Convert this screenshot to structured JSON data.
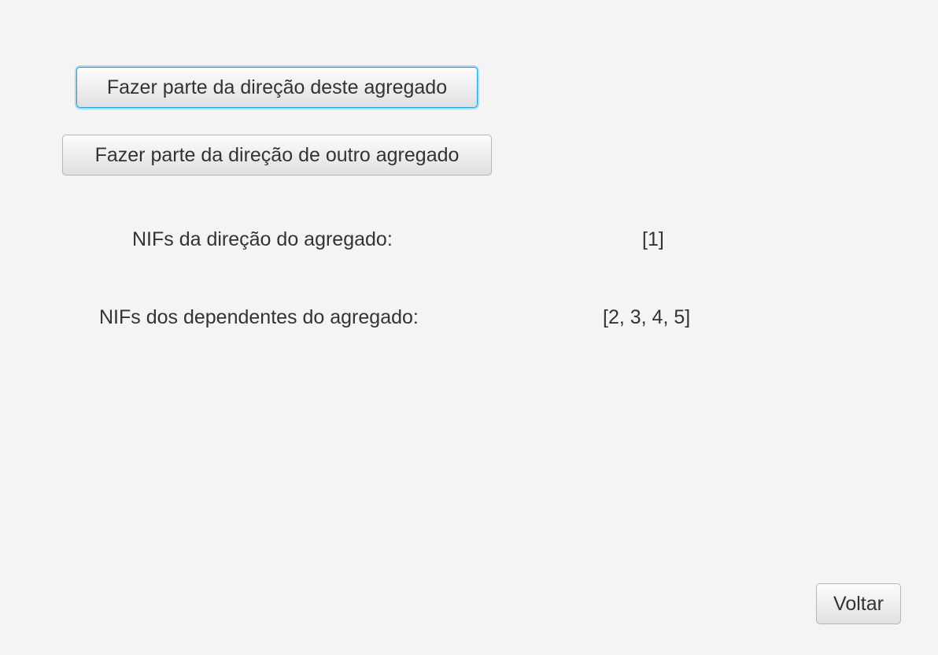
{
  "buttons": {
    "join_this": "Fazer parte da direção deste agregado",
    "join_other": "Fazer parte da direção de outro agregado",
    "back": "Voltar"
  },
  "info": {
    "direction_label": "NIFs da direção do agregado:",
    "direction_value": "[1]",
    "dependents_label": "NIFs dos dependentes do agregado:",
    "dependents_value": "[2, 3, 4, 5]"
  }
}
